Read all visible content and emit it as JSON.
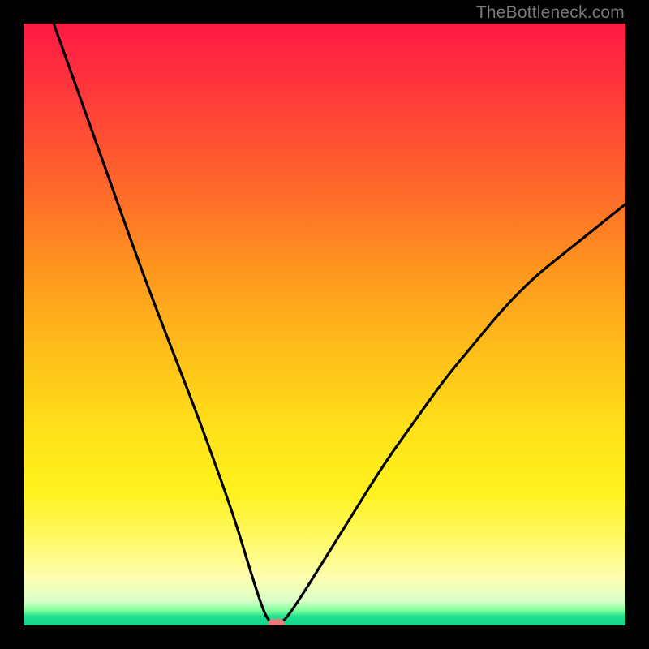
{
  "watermark": {
    "text": "TheBottleneck.com"
  },
  "colors": {
    "curve_stroke": "#000000",
    "marker_fill": "#e77c7c",
    "marker_stroke": "#c95b5b",
    "background_black": "#000000"
  },
  "chart_data": {
    "type": "line",
    "title": "",
    "xlabel": "",
    "ylabel": "",
    "xlim": [
      0,
      100
    ],
    "ylim": [
      0,
      100
    ],
    "grid": false,
    "legend": false,
    "series": [
      {
        "name": "bottleneck-curve",
        "x": [
          5,
          10,
          15,
          20,
          25,
          30,
          35,
          38,
          40,
          41,
          42,
          43,
          45,
          50,
          55,
          60,
          65,
          70,
          75,
          80,
          85,
          90,
          95,
          100
        ],
        "y": [
          100,
          86,
          72,
          58,
          45,
          32,
          18,
          8,
          2,
          0.5,
          0,
          0.5,
          3,
          11,
          19,
          27,
          34,
          41,
          47,
          53,
          58,
          62,
          66,
          70
        ]
      }
    ],
    "marker": {
      "x": 42,
      "y": 0,
      "shape": "rounded-rect"
    },
    "gradient_stops": [
      {
        "pct": 0,
        "color": "#ff1a44"
      },
      {
        "pct": 50,
        "color": "#ffc21a"
      },
      {
        "pct": 92,
        "color": "#ffffb0"
      },
      {
        "pct": 100,
        "color": "#18d488"
      }
    ]
  }
}
